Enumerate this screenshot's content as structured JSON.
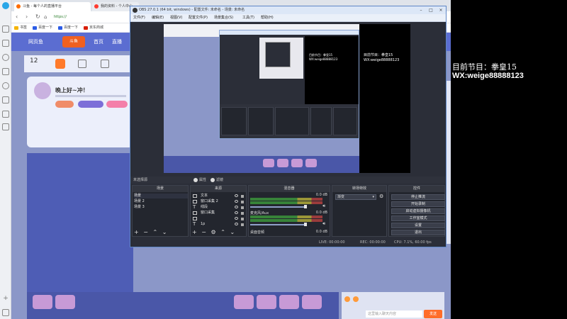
{
  "browser": {
    "tabs": [
      {
        "title": "斗鱼 - 每个人的直播平台"
      },
      {
        "title": "我的资料 - 个人中心"
      }
    ],
    "url": "https://",
    "bookmarks": [
      {
        "label": "书签"
      },
      {
        "label": "百度一下"
      },
      {
        "label": "百度一下"
      },
      {
        "label": "京东商城"
      }
    ],
    "page": {
      "nav": [
        "网页鱼",
        "首页",
        "直播"
      ],
      "stat_value": "12",
      "greeting": "晚上好~冲！",
      "pills": [
        "",
        ""
      ],
      "chat_placeholder": "这里输入聊天内容",
      "send_label": "发送"
    }
  },
  "obs": {
    "title": "OBS 27.0.1 (64 bit, windows) - 配置文件: 未命名 - 场景: 未命名",
    "menu": [
      "文件(F)",
      "编辑(E)",
      "视图(V)",
      "配置文件(P)",
      "场景集合(S)",
      "工具(T)",
      "帮助(H)"
    ],
    "source_bar": {
      "active_label": "未选择源",
      "properties": "属性",
      "filters": "滤镜"
    },
    "scenes": {
      "header": "场景",
      "items": [
        "场景",
        "场景 2",
        "场景 3"
      ]
    },
    "sources": {
      "header": "来源",
      "items": [
        "文本",
        "窗口采集 2",
        "线段",
        "窗口采集",
        "",
        "1p"
      ]
    },
    "mixer": {
      "header": "混音器",
      "channels": [
        {
          "name": "",
          "db": "0.0 dB"
        },
        {
          "name": "麦克风/Aux",
          "db": "0.0 dB"
        },
        {
          "name": "桌面音频",
          "db": "0.0 dB"
        }
      ]
    },
    "transitions": {
      "header": "转场特效",
      "selected": "渐变"
    },
    "controls": {
      "header": "控件",
      "buttons": [
        "停止推流",
        "开始录制",
        "启动虚拟摄像机",
        "工作室模式",
        "设置",
        "退出"
      ]
    },
    "status": {
      "live": "LIVE: 00:00:00",
      "rec": "REC: 00:00:00",
      "cpu": "CPU: 7.1%, 60.00 fps"
    },
    "preview_text": [
      "目前节目：拳皇15",
      "WX:weige88888123"
    ]
  },
  "overlay": {
    "line1": "目前节目：拳皇15",
    "line2": "WX:weige88888123"
  },
  "colors": {
    "obs_bg": "#2b2e38",
    "page_purple": "#8b97c8",
    "accent_orange": "#ff6d2a"
  }
}
